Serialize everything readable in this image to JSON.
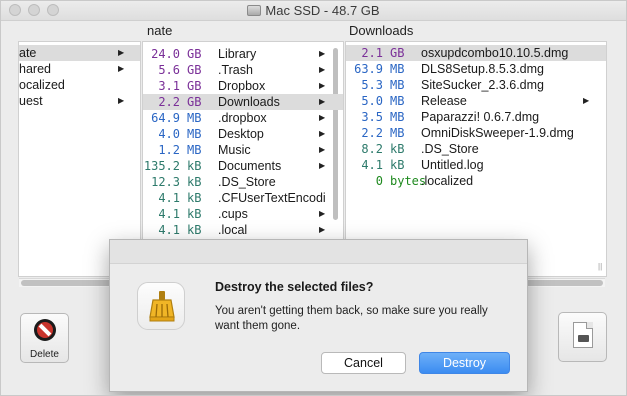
{
  "window": {
    "title": "Mac SSD - 48.7 GB"
  },
  "columns": [
    {
      "header": ""
    },
    {
      "header": "nate"
    },
    {
      "header": "Downloads"
    }
  ],
  "pane1": {
    "items": [
      {
        "name": "ate",
        "arrow": "▶",
        "selected": true
      },
      {
        "name": "hared",
        "arrow": "▶"
      },
      {
        "name": "ocalized",
        "arrow": ""
      },
      {
        "name": "uest",
        "arrow": "▶"
      }
    ]
  },
  "pane2": {
    "items": [
      {
        "size": "24.0",
        "unit": "GB",
        "name": "Library",
        "arrow": "▶",
        "color": "purple"
      },
      {
        "size": "5.6",
        "unit": "GB",
        "name": ".Trash",
        "arrow": "▶",
        "color": "purple"
      },
      {
        "size": "3.1",
        "unit": "GB",
        "name": "Dropbox",
        "arrow": "▶",
        "color": "purple"
      },
      {
        "size": "2.2",
        "unit": "GB",
        "name": "Downloads",
        "arrow": "▶",
        "color": "purple",
        "selected": true
      },
      {
        "size": "64.9",
        "unit": "MB",
        "name": ".dropbox",
        "arrow": "▶",
        "color": "blue"
      },
      {
        "size": "4.0",
        "unit": "MB",
        "name": "Desktop",
        "arrow": "▶",
        "color": "blue"
      },
      {
        "size": "1.2",
        "unit": "MB",
        "name": "Music",
        "arrow": "▶",
        "color": "blue"
      },
      {
        "size": "135.2",
        "unit": "kB",
        "name": "Documents",
        "arrow": "▶",
        "color": "teal"
      },
      {
        "size": "12.3",
        "unit": "kB",
        "name": ".DS_Store",
        "arrow": "",
        "color": "teal"
      },
      {
        "size": "4.1",
        "unit": "kB",
        "name": ".CFUserTextEncodi",
        "arrow": "",
        "color": "teal"
      },
      {
        "size": "4.1",
        "unit": "kB",
        "name": ".cups",
        "arrow": "▶",
        "color": "teal"
      },
      {
        "size": "4.1",
        "unit": "kB",
        "name": ".local",
        "arrow": "▶",
        "color": "teal"
      }
    ]
  },
  "pane3": {
    "items": [
      {
        "size": "2.1",
        "unit": "GB",
        "name": "osxupdcombo10.10.5.dmg",
        "arrow": "",
        "color": "purple",
        "selected": true
      },
      {
        "size": "63.9",
        "unit": "MB",
        "name": "DLS8Setup.8.5.3.dmg",
        "arrow": "",
        "color": "blue"
      },
      {
        "size": "5.3",
        "unit": "MB",
        "name": "SiteSucker_2.3.6.dmg",
        "arrow": "",
        "color": "blue"
      },
      {
        "size": "5.0",
        "unit": "MB",
        "name": "Release",
        "arrow": "▶",
        "color": "blue"
      },
      {
        "size": "3.5",
        "unit": "MB",
        "name": "Paparazzi! 0.6.7.dmg",
        "arrow": "",
        "color": "blue"
      },
      {
        "size": "2.2",
        "unit": "MB",
        "name": "OmniDiskSweeper-1.9.dmg",
        "arrow": "",
        "color": "blue"
      },
      {
        "size": "8.2",
        "unit": "kB",
        "name": ".DS_Store",
        "arrow": "",
        "color": "teal"
      },
      {
        "size": "4.1",
        "unit": "kB",
        "name": "Untitled.log",
        "arrow": "",
        "color": "teal"
      },
      {
        "size": "0",
        "unit": "bytes",
        "name": ".localized",
        "arrow": "",
        "color": "green"
      }
    ]
  },
  "toolbar": {
    "delete_label": "Delete"
  },
  "dialog": {
    "title": "Destroy the selected files?",
    "message": "You aren't getting them back, so make sure you really want them gone.",
    "cancel_label": "Cancel",
    "destroy_label": "Destroy",
    "accent_color": "#3b8cf1"
  }
}
